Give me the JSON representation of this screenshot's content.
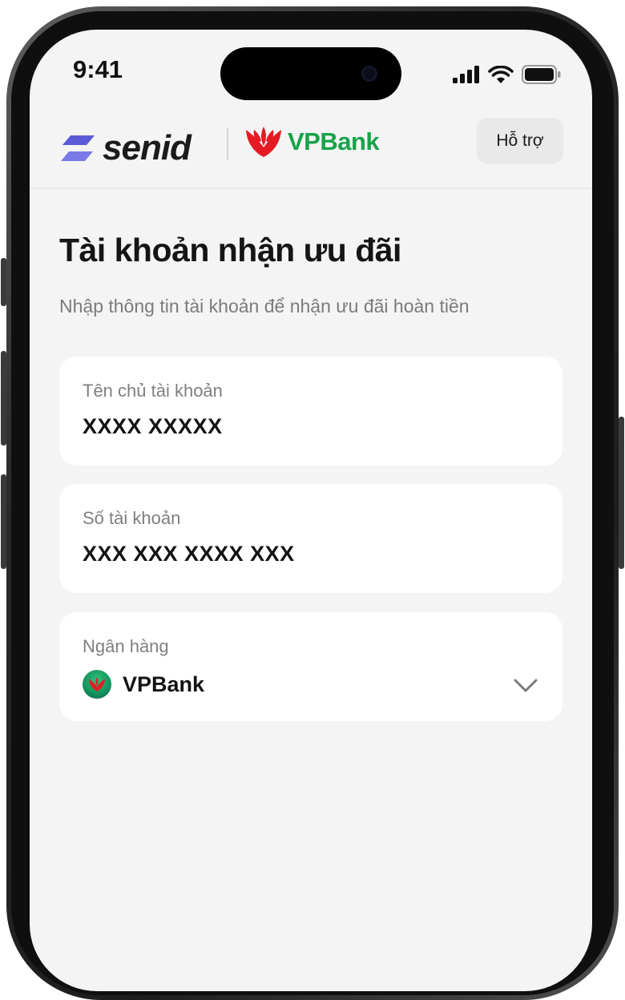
{
  "status_bar": {
    "time": "9:41",
    "icons": [
      "cellular-signal-icon",
      "wifi-icon",
      "battery-icon"
    ]
  },
  "header": {
    "brand_logo_text": "senid",
    "partner_logo_text": "VPBank",
    "support_label": "Hỗ trợ"
  },
  "page": {
    "title": "Tài khoản nhận ưu đãi",
    "subtitle": "Nhập thông tin tài khoản để nhận ưu đãi hoàn tiền"
  },
  "form": {
    "account_name": {
      "label": "Tên chủ tài khoản",
      "value": "XXXX XXXXX"
    },
    "account_number": {
      "label": "Số tài khoản",
      "value": "XXX XXX XXXX XXX"
    },
    "bank": {
      "label": "Ngân hàng",
      "value": "VPBank",
      "icon": "chevron-down-icon"
    }
  },
  "colors": {
    "background": "#f4f4f4",
    "card": "#ffffff",
    "vpbank_green": "#17a34a",
    "vpbank_red": "#e51b23",
    "senid_purple": "#5b5bd6"
  }
}
